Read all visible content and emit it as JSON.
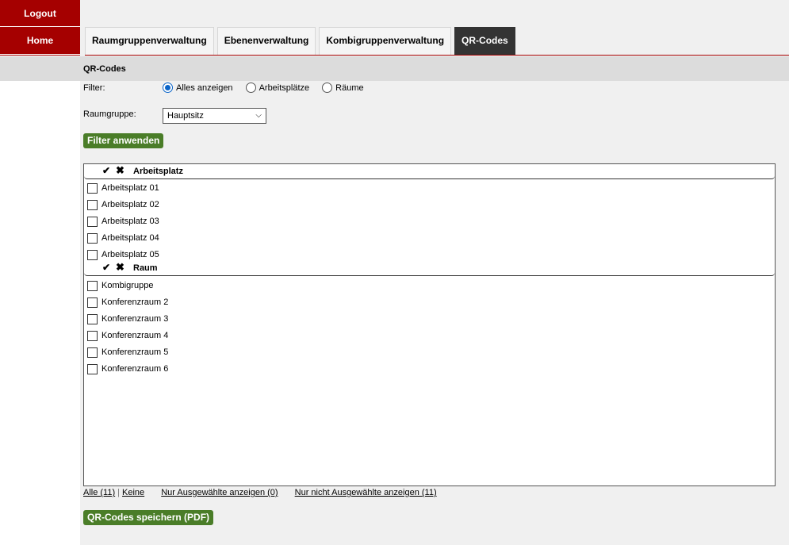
{
  "nav": {
    "logout": "Logout",
    "home": "Home"
  },
  "tabs": [
    {
      "label": "Raumgruppenverwaltung"
    },
    {
      "label": "Ebenenverwaltung"
    },
    {
      "label": "Kombigruppenverwaltung"
    },
    {
      "label": "QR-Codes",
      "active": true
    }
  ],
  "page": {
    "title": "QR-Codes"
  },
  "filter": {
    "label": "Filter:",
    "options": [
      {
        "label": "Alles anzeigen",
        "checked": true
      },
      {
        "label": "Arbeitsplätze",
        "checked": false
      },
      {
        "label": "Räume",
        "checked": false
      }
    ]
  },
  "raumgruppe": {
    "label": "Raumgruppe:",
    "value": "Hauptsitz"
  },
  "buttons": {
    "apply": "Filter anwenden",
    "save": "QR-Codes speichern (PDF)"
  },
  "groups": [
    {
      "title": "Arbeitsplatz",
      "items": [
        "Arbeitsplatz 01",
        "Arbeitsplatz 02",
        "Arbeitsplatz 03",
        "Arbeitsplatz 04",
        "Arbeitsplatz 05"
      ]
    },
    {
      "title": "Raum",
      "items": [
        "Kombigruppe",
        "Konferenzraum 2",
        "Konferenzraum 3",
        "Konferenzraum 4",
        "Konferenzraum 5",
        "Konferenzraum 6"
      ]
    }
  ],
  "links": {
    "all": "Alle (11)",
    "none": "Keine",
    "only_selected": "Nur Ausgewählte anzeigen (0)",
    "only_unselected": "Nur nicht Ausgewählte anzeigen (11)"
  },
  "colors": {
    "brand_red": "#a50000",
    "button_green": "#4a7d28",
    "active_tab": "#333333",
    "radio_blue": "#0a64c8"
  }
}
